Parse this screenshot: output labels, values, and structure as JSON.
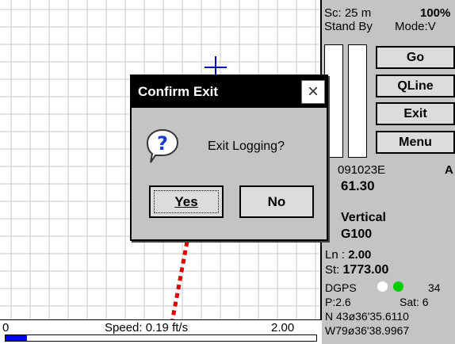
{
  "speed_bar": {
    "left": "0",
    "center": "Speed: 0.19 ft/s",
    "right": "2.00",
    "progress_pct": 7
  },
  "status": {
    "scale": "Sc:  25 m",
    "percent": "100%",
    "state": "Stand By",
    "mode": "Mode:V"
  },
  "buttons": {
    "go": "Go",
    "qline": "QLine",
    "exit": "Exit",
    "menu": "Menu"
  },
  "info": {
    "file": "091023E",
    "flag": "A",
    "value": "61.30",
    "orientation": "Vertical",
    "grid": "G100",
    "ln_label": "Ln : ",
    "ln_value": "2.00",
    "st_label": "St:  ",
    "st_value": "1773.00",
    "dgps": "DGPS",
    "dgps_num": "34",
    "p": "P:2.6",
    "sat": "Sat:  6",
    "lat": "N 43ø36'35.6110",
    "lon": "W79ø36'38.9967"
  },
  "dialog": {
    "title": "Confirm Exit",
    "close": "×",
    "message": "Exit Logging?",
    "yes": "Yes",
    "no": "No"
  },
  "colors": {
    "map_grid": "#c8c8c8",
    "crosshair": "#0000c0",
    "track": "#e00000",
    "progress": "#0000ff",
    "dot_white": "#ffffff",
    "dot_green": "#00cc00"
  }
}
